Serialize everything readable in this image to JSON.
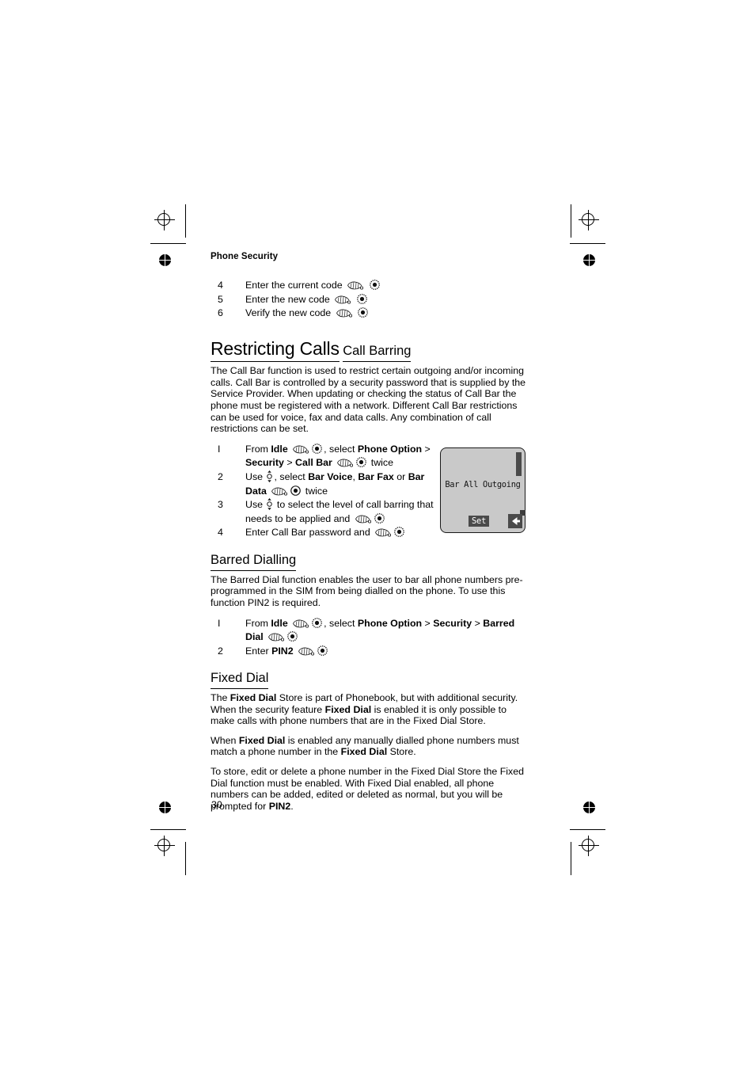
{
  "document": {
    "running_head": "Phone Security",
    "page_number": "30"
  },
  "icons": {
    "press_key": "press-key-icon",
    "ok_key": "ok-key-icon",
    "nav_key": "navigation-key-icon",
    "back_key": "back-arrow-icon"
  },
  "top_steps": [
    {
      "num": "4",
      "text": "Enter the current code"
    },
    {
      "num": "5",
      "text": "Enter the new code"
    },
    {
      "num": "6",
      "text": "Verify the new code"
    }
  ],
  "section": {
    "title": "Restricting Calls"
  },
  "call_barring": {
    "title": "Call Barring",
    "intro": "The Call Bar function is used to restrict certain outgoing and/or incoming calls. Call Bar is controlled by a security password that is supplied by  the Service Provider. When updating or checking the status of Call Bar the phone must be registered with a network. Different Call Bar restrictions can be used for voice, fax and data calls. Any combination of call restrictions can be set.",
    "steps": {
      "s1_a": "From ",
      "s1_idle": "Idle",
      "s1_b": ", select ",
      "s1_phone_option": "Phone Option",
      "s1_gt1": " > ",
      "s1_security": "Security",
      "s1_gt2": " > ",
      "s1_call_bar": "Call Bar",
      "s1_c": " twice",
      "s2_a": "Use ",
      "s2_b": ", select  ",
      "s2_bar_voice": "Bar Voice",
      "s2_comma": ", ",
      "s2_bar_fax": "Bar Fax",
      "s2_or": " or ",
      "s2_bar_data": "Bar Data",
      "s2_c": " twice",
      "s3_a": "Use ",
      "s3_b": " to select the level of call barring that needs to be applied and ",
      "s4_a": "Enter Call Bar password and "
    },
    "nums": [
      "I",
      "2",
      "3",
      "4"
    ]
  },
  "lcd": {
    "message": "Bar All Outgoing",
    "softkey_label": "Set"
  },
  "barred_dialling": {
    "title": "Barred Dialling",
    "intro": "The Barred Dial function enables the user to bar all phone numbers pre-programmed in the SIM from being dialled on the phone. To use this function PIN2 is required.",
    "steps": {
      "s1_a": "From ",
      "s1_idle": "Idle",
      "s1_b": ", select ",
      "s1_phone_option": "Phone Option",
      "s1_gt1": " > ",
      "s1_security": "Security",
      "s1_gt2": " > ",
      "s1_barred_dial": "Barred Dial",
      "s2_a": "Enter ",
      "s2_pin2": "PIN2"
    },
    "nums": [
      "I",
      "2"
    ]
  },
  "fixed_dial": {
    "title": "Fixed Dial",
    "p1_a": "The ",
    "p1_b1": "Fixed Dial",
    "p1_c": " Store is part of Phonebook, but with additional security. When the security feature ",
    "p1_b2": "Fixed Dial",
    "p1_d": " is enabled it is only possible to make calls with phone numbers that are in the Fixed Dial Store.",
    "p2_a": "When ",
    "p2_b1": "Fixed Dial",
    "p2_c": " is enabled any manually dialled phone numbers must match a phone number in the ",
    "p2_b2": "Fixed Dial",
    "p2_d": " Store.",
    "p3_a": "To store, edit or delete a phone number in the Fixed Dial Store the Fixed Dial function must be enabled. With Fixed Dial enabled, all phone numbers can be added, edited or deleted as normal, but you will be prompted for ",
    "p3_b": "PIN2",
    "p3_c": "."
  }
}
